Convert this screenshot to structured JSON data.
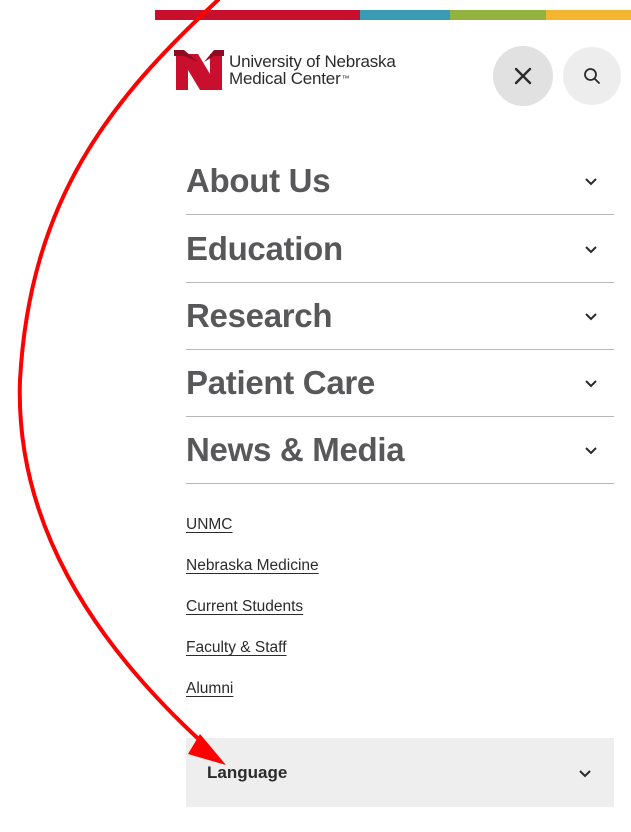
{
  "colors": {
    "brand_red": "#c8102e",
    "band_teal": "#3a9bb4",
    "band_green": "#92b33f",
    "band_yellow": "#f2b631",
    "annotation_red": "#ff0000"
  },
  "header": {
    "logo_line1": "University of Nebraska",
    "logo_line2": "Medical Center",
    "logo_trademark": "™",
    "close_icon": "close-icon",
    "search_icon": "search-icon"
  },
  "menu": {
    "items": [
      {
        "label": "About Us"
      },
      {
        "label": "Education"
      },
      {
        "label": "Research"
      },
      {
        "label": "Patient Care"
      },
      {
        "label": "News & Media"
      }
    ]
  },
  "links": {
    "items": [
      {
        "label": "UNMC"
      },
      {
        "label": "Nebraska Medicine"
      },
      {
        "label": "Current Students"
      },
      {
        "label": "Faculty & Staff"
      },
      {
        "label": "Alumni"
      }
    ]
  },
  "language": {
    "label": "Language"
  }
}
